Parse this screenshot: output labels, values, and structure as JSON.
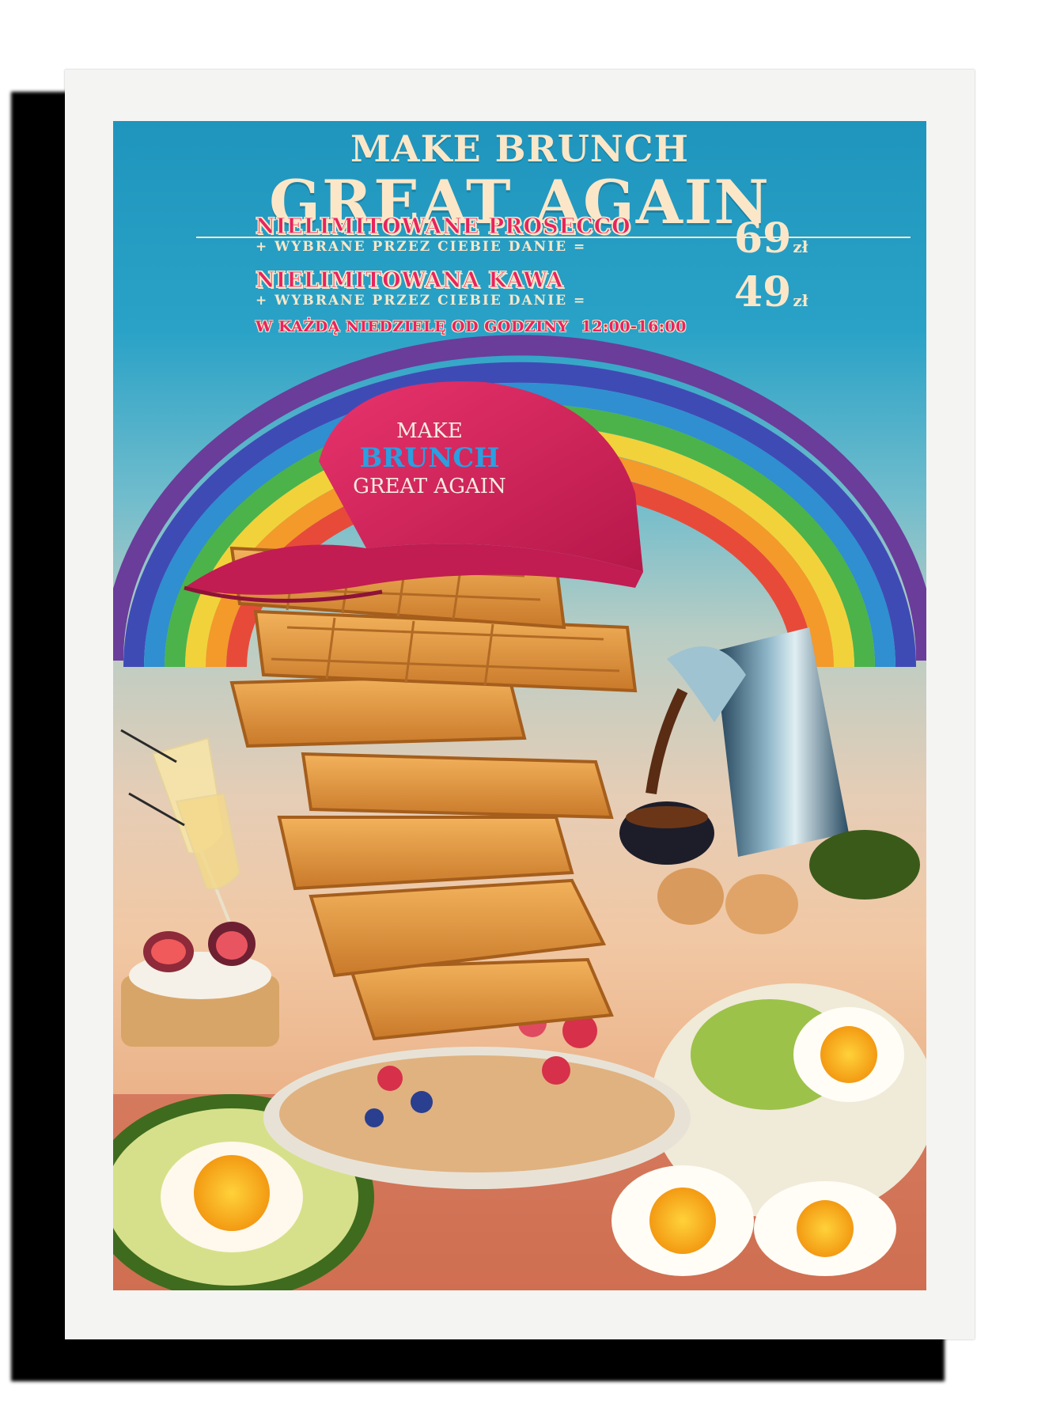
{
  "poster": {
    "headline_line1": "MAKE BRUNCH",
    "headline_line2": "GREAT AGAIN",
    "offer1": {
      "title": "NIELIMITOWANE PROSECCO",
      "subtitle": "+ WYBRANE PRZEZ CIEBIE DANIE =",
      "price": "69",
      "currency": "zł"
    },
    "offer2": {
      "title": "NIELIMITOWANA KAWA",
      "subtitle": "+ WYBRANE PRZEZ CIEBIE DANIE =",
      "price": "49",
      "currency": "zł"
    },
    "hours_label": "W KAŻDĄ NIEDZIELĘ OD GODZINY",
    "hours_time": "12:00-16:00",
    "cap": {
      "line1": "MAKE",
      "line2": "BRUNCH",
      "line3": "GREAT AGAIN"
    }
  },
  "colors": {
    "accent_pink": "#e8245e",
    "cream": "#fbe7c8",
    "sky_blue": "#1f95bd",
    "cap_red": "#d81e5b",
    "cap_blue_text": "#2b9fe0"
  },
  "icons": [
    "rainbow-illustration",
    "waffle-stack-illustration",
    "cap-illustration",
    "coffee-pot-illustration",
    "champagne-glass-illustration",
    "avocado-illustration",
    "fried-egg-illustration"
  ]
}
